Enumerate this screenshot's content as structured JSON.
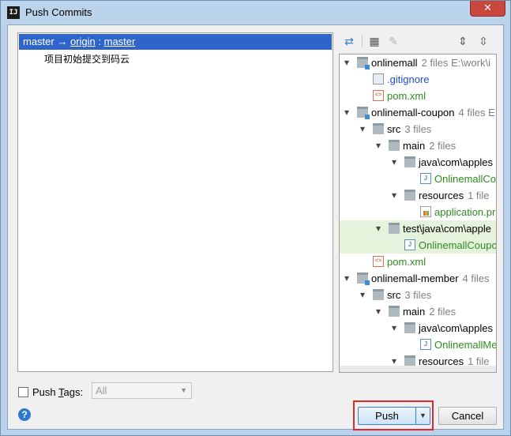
{
  "window": {
    "title": "Push Commits",
    "app_icon_text": "IJ",
    "close_glyph": "✕"
  },
  "commits": {
    "header": {
      "local": "master",
      "arrow": " → ",
      "remote": "origin",
      "sep": " : ",
      "remote_branch": "master"
    },
    "items": [
      "项目初始提交到码云"
    ]
  },
  "toolbar": {
    "icons": [
      "pull-arrows-icon",
      "group-icon",
      "edit-icon",
      "expand-all-icon",
      "collapse-all-icon"
    ]
  },
  "tree": {
    "rows": [
      {
        "label": "onlinemall",
        "meta": "2 files  E:\\work\\i",
        "icon": "module",
        "depth": 0,
        "arrow": "open"
      },
      {
        "label": ".gitignore",
        "meta": "",
        "icon": "file",
        "depth": 1,
        "arrow": "",
        "color": "blue"
      },
      {
        "label": "pom.xml",
        "meta": "",
        "icon": "xml",
        "depth": 1,
        "arrow": "",
        "color": "green"
      },
      {
        "label": "onlinemall-coupon",
        "meta": "4 files  E",
        "icon": "module",
        "depth": 0,
        "arrow": "open"
      },
      {
        "label": "src",
        "meta": "3 files",
        "icon": "folder",
        "depth": 1,
        "arrow": "open"
      },
      {
        "label": "main",
        "meta": "2 files",
        "icon": "folder",
        "depth": 2,
        "arrow": "open"
      },
      {
        "label": "java\\com\\apples",
        "meta": "",
        "icon": "folder",
        "depth": 3,
        "arrow": "open"
      },
      {
        "label": "OnlinemallCo",
        "meta": "",
        "icon": "java",
        "depth": 4,
        "arrow": "",
        "color": "green"
      },
      {
        "label": "resources",
        "meta": "1 file",
        "icon": "folder",
        "depth": 3,
        "arrow": "open"
      },
      {
        "label": "application.pr",
        "meta": "",
        "icon": "prop",
        "depth": 4,
        "arrow": "",
        "color": "green"
      },
      {
        "label": "test\\java\\com\\apple",
        "meta": "",
        "icon": "folder",
        "depth": 2,
        "arrow": "open",
        "hl": true
      },
      {
        "label": "OnlinemallCoupc",
        "meta": "",
        "icon": "java",
        "depth": 3,
        "arrow": "",
        "color": "green",
        "hl": true
      },
      {
        "label": "pom.xml",
        "meta": "",
        "icon": "xml",
        "depth": 1,
        "arrow": "",
        "color": "green"
      },
      {
        "label": "onlinemall-member",
        "meta": "4 files",
        "icon": "module",
        "depth": 0,
        "arrow": "open"
      },
      {
        "label": "src",
        "meta": "3 files",
        "icon": "folder",
        "depth": 1,
        "arrow": "open"
      },
      {
        "label": "main",
        "meta": "2 files",
        "icon": "folder",
        "depth": 2,
        "arrow": "open"
      },
      {
        "label": "java\\com\\apples",
        "meta": "",
        "icon": "folder",
        "depth": 3,
        "arrow": "open"
      },
      {
        "label": "OnlinemallMe",
        "meta": "",
        "icon": "java",
        "depth": 4,
        "arrow": "",
        "color": "green"
      },
      {
        "label": "resources",
        "meta": "1 file",
        "icon": "folder",
        "depth": 3,
        "arrow": "open"
      }
    ]
  },
  "footer": {
    "push_tags_label_prefix": "Push ",
    "push_tags_mnemonic": "T",
    "push_tags_label_suffix": "ags:",
    "tags_select_value": "All",
    "help_label": "?",
    "push_label": "Push",
    "cancel_label": "Cancel"
  },
  "colors": {
    "selection": "#2f65ca",
    "highlight_row": "#e6f3dc",
    "push_outline": "#e0272b",
    "green_text": "#2e8a1e",
    "blue_text": "#1a4fc9"
  }
}
